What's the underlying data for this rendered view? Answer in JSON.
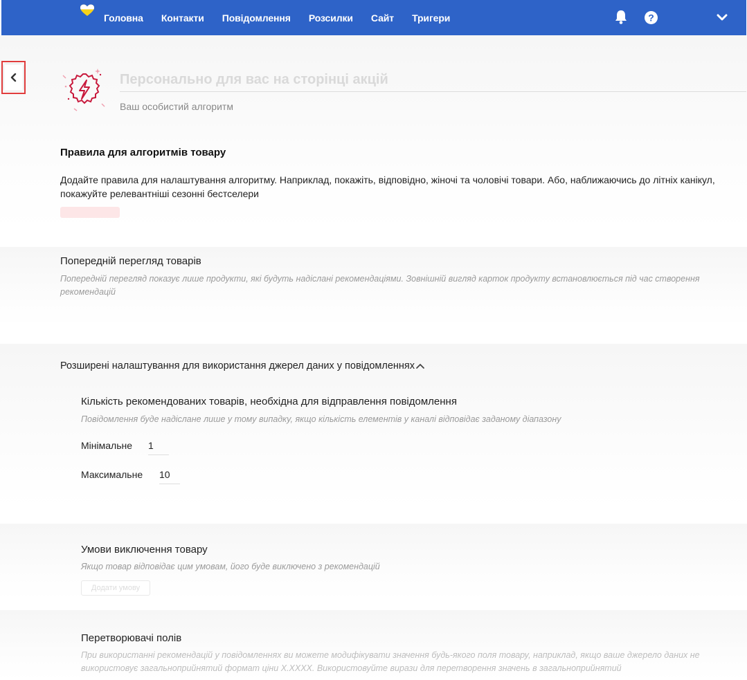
{
  "nav": {
    "items": [
      "Головна",
      "Контакти",
      "Повідомлення",
      "Розсилки",
      "Сайт",
      "Тригери"
    ],
    "icons": [
      "ukraine-heart-logo",
      "bell-icon",
      "help-icon",
      "chevron-down-icon"
    ]
  },
  "back_button": {
    "icon": "chevron-left-icon"
  },
  "hero": {
    "title": "Персонально для вас на сторінці акцій",
    "subtitle": "Ваш особистий алгоритм"
  },
  "rules": {
    "title": "Правила для алгоритмів товару",
    "description": "Додайте правила для налаштування алгоритму. Наприклад, покажіть, відповідно, жіночі та чоловічі товари. Або, наближаючись до літніх канікул, покажуйте релевантніші сезонні бестселери"
  },
  "preview": {
    "title": "Попередній перегляд товарів",
    "description": "Попередній перегляд показує лише продукти, які будуть надіслані рекомендаціями. Зовнішній вигляд карток продукту встановлюється під час створення рекомендацій"
  },
  "advanced": {
    "toggle_label": "Розширені налаштування для використання джерел даних у повідомленнях",
    "count": {
      "title": "Кількість рекомендованих товарів, необхідна для відправлення повідомлення",
      "description": "Повідомлення буде надіслане лише у тому випадку, якщо кількість елементів у каналі відповідає заданому діапазону",
      "min_label": "Мінімальне",
      "min_value": "1",
      "max_label": "Максимальне",
      "max_value": "10"
    },
    "exclusion": {
      "title": "Умови виключення товару",
      "description": "Якщо товар відповідає цим умовам, його буде виключено з рекомендацій",
      "add_button": "Додати умову"
    },
    "transformers": {
      "title": "Перетворювачі полів",
      "description": "При використанні рекомендацій у повідомленнях ви можете модифікувати значення будь-якого поля товару, наприклад, якщо ваше джерело даних не використовує загальноприйнятий формат ціни X.XXXX. Використовуйте вирази для перетворення значень в загальноприйнятий"
    }
  },
  "colors": {
    "brand": "#2e63c8",
    "highlight": "#e03c3c",
    "accent": "#c8193c"
  }
}
